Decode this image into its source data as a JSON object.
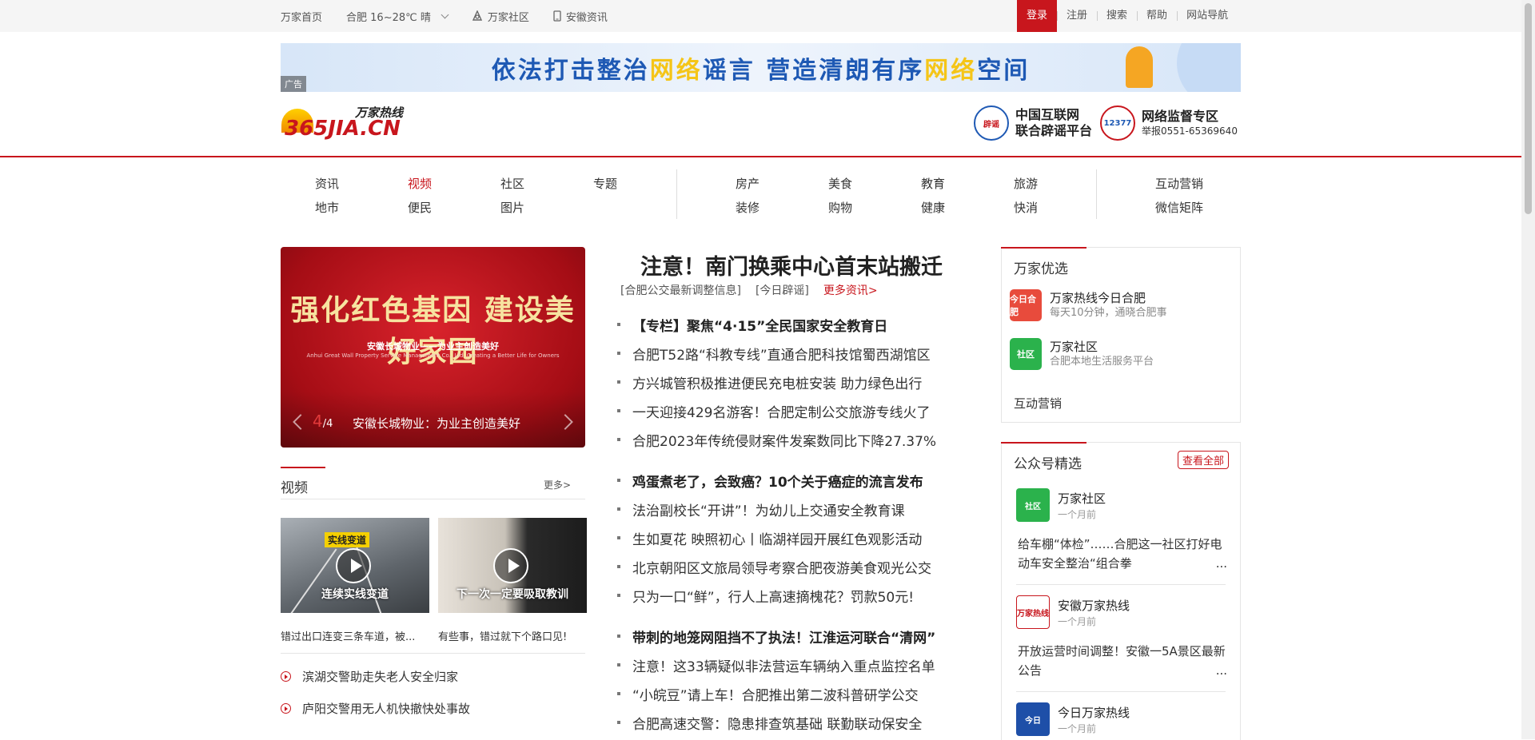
{
  "topbar": {
    "home": "万家首页",
    "weather": "合肥 16~28℃ 晴",
    "community": "万家社区",
    "anhui_news": "安徽资讯",
    "login": "登录",
    "register": "注册",
    "search": "搜索",
    "help": "帮助",
    "site_nav": "网站导航"
  },
  "banner": {
    "text_a": "依法打击整治",
    "text_b": "网络",
    "text_c": "谣言  营造清朗有序",
    "text_d": "网络",
    "text_e": "空间",
    "ad_tag": "广告"
  },
  "logo": {
    "wanjia": "万家热线",
    "main": "365JIA.CN"
  },
  "partners": [
    {
      "icon": "辟谣",
      "line1": "中国互联网",
      "line2": "联合辟谣平台"
    },
    {
      "icon": "12377",
      "line1": "网络监督专区",
      "line2": "举报0551-65369640"
    }
  ],
  "nav": {
    "group1": [
      "资讯",
      "视频",
      "社区",
      "专题",
      "地市",
      "便民",
      "图片"
    ],
    "group2": [
      "房产",
      "美食",
      "教育",
      "旅游",
      "装修",
      "购物",
      "健康",
      "快消"
    ],
    "group3": [
      "互动营销",
      "微信矩阵"
    ],
    "active": "视频"
  },
  "carousel": {
    "image_title": "强化红色基因 建设美好家园",
    "image_sub": "安徽长城物业——为业主创造美好",
    "image_sub_en": "Anhui Great Wall Property Service Management Co., Ltd. Creating a Better Life for Owners",
    "current": "4",
    "total": "/4",
    "caption": "安徽长城物业：为业主创造美好"
  },
  "video": {
    "title": "视频",
    "more": "更多>",
    "items": [
      {
        "tag": "实线变道",
        "overlay": "连续实线变道",
        "caption": "错过出口连变三条车道，被..."
      },
      {
        "overlay": "下一次一定要吸取教训",
        "caption": "有些事，错过就下个路口见!"
      }
    ],
    "list": [
      "滨湖交警助走失老人安全归家",
      "庐阳交警用无人机快撤快处事故"
    ]
  },
  "news": {
    "headline": "注意！南门换乘中心首末站搬迁",
    "tags": [
      "[合肥公交最新调整信息]",
      "[今日辟谣]",
      "更多资讯>"
    ],
    "groups": [
      [
        "【专栏】聚焦“4·15”全民国家安全教育日",
        "合肥T52路“科教专线”直通合肥科技馆蜀西湖馆区",
        "方兴城管积极推进便民充电桩安装 助力绿色出行",
        "一天迎接429名游客！合肥定制公交旅游专线火了",
        "合肥2023年传统侵财案件发案数同比下降27.37%"
      ],
      [
        "鸡蛋煮老了，会致癌？10个关于癌症的流言发布",
        "法治副校长“开讲”！为幼儿上交通安全教育课",
        "生如夏花 映照初心丨临湖祥园开展红色观影活动",
        "北京朝阳区文旅局领导考察合肥夜游美食观光公交",
        "只为一口“鲜”，行人上高速摘槐花？罚款50元!"
      ],
      [
        "带刺的地笼网阻挡不了执法！江淮运河联合“清网”",
        "注意！这33辆疑似非法营运车辆纳入重点监控名单",
        "“小皖豆”请上车！合肥推出第二波科普研学公交",
        "合肥高速交警：隐患排查筑基础 联勤联动保安全"
      ]
    ]
  },
  "youxuan": {
    "title": "万家优选",
    "items": [
      {
        "icon": "今日合肥",
        "name": "万家热线今日合肥",
        "desc": "每天10分钟，通晓合肥事",
        "color": "#e84b3c"
      },
      {
        "icon": "社区",
        "name": "万家社区",
        "desc": "合肥本地生活服务平台",
        "color": "#2bb24c"
      }
    ],
    "extra": "互动营销"
  },
  "gzh": {
    "title": "公众号精选",
    "view_all": "查看全部",
    "items": [
      {
        "icon": "社区",
        "color": "#2bb24c",
        "name": "万家社区",
        "time": "一个月前",
        "excerpt": "给车棚“体检”……合肥这一社区打好电动车安全整治“组合拳",
        "dots": "..."
      },
      {
        "icon": "万家热线",
        "color": "#ffffff",
        "name": "安徽万家热线",
        "time": "一个月前",
        "excerpt": "开放运营时间调整！安徽一5A景区最新公告",
        "dots": "..."
      },
      {
        "icon": "今日",
        "color": "#1e4fa8",
        "name": "今日万家热线",
        "time": "一个月前"
      }
    ]
  },
  "colors": {
    "accent": "#c8161d",
    "link_blue": "#1e59b4"
  }
}
